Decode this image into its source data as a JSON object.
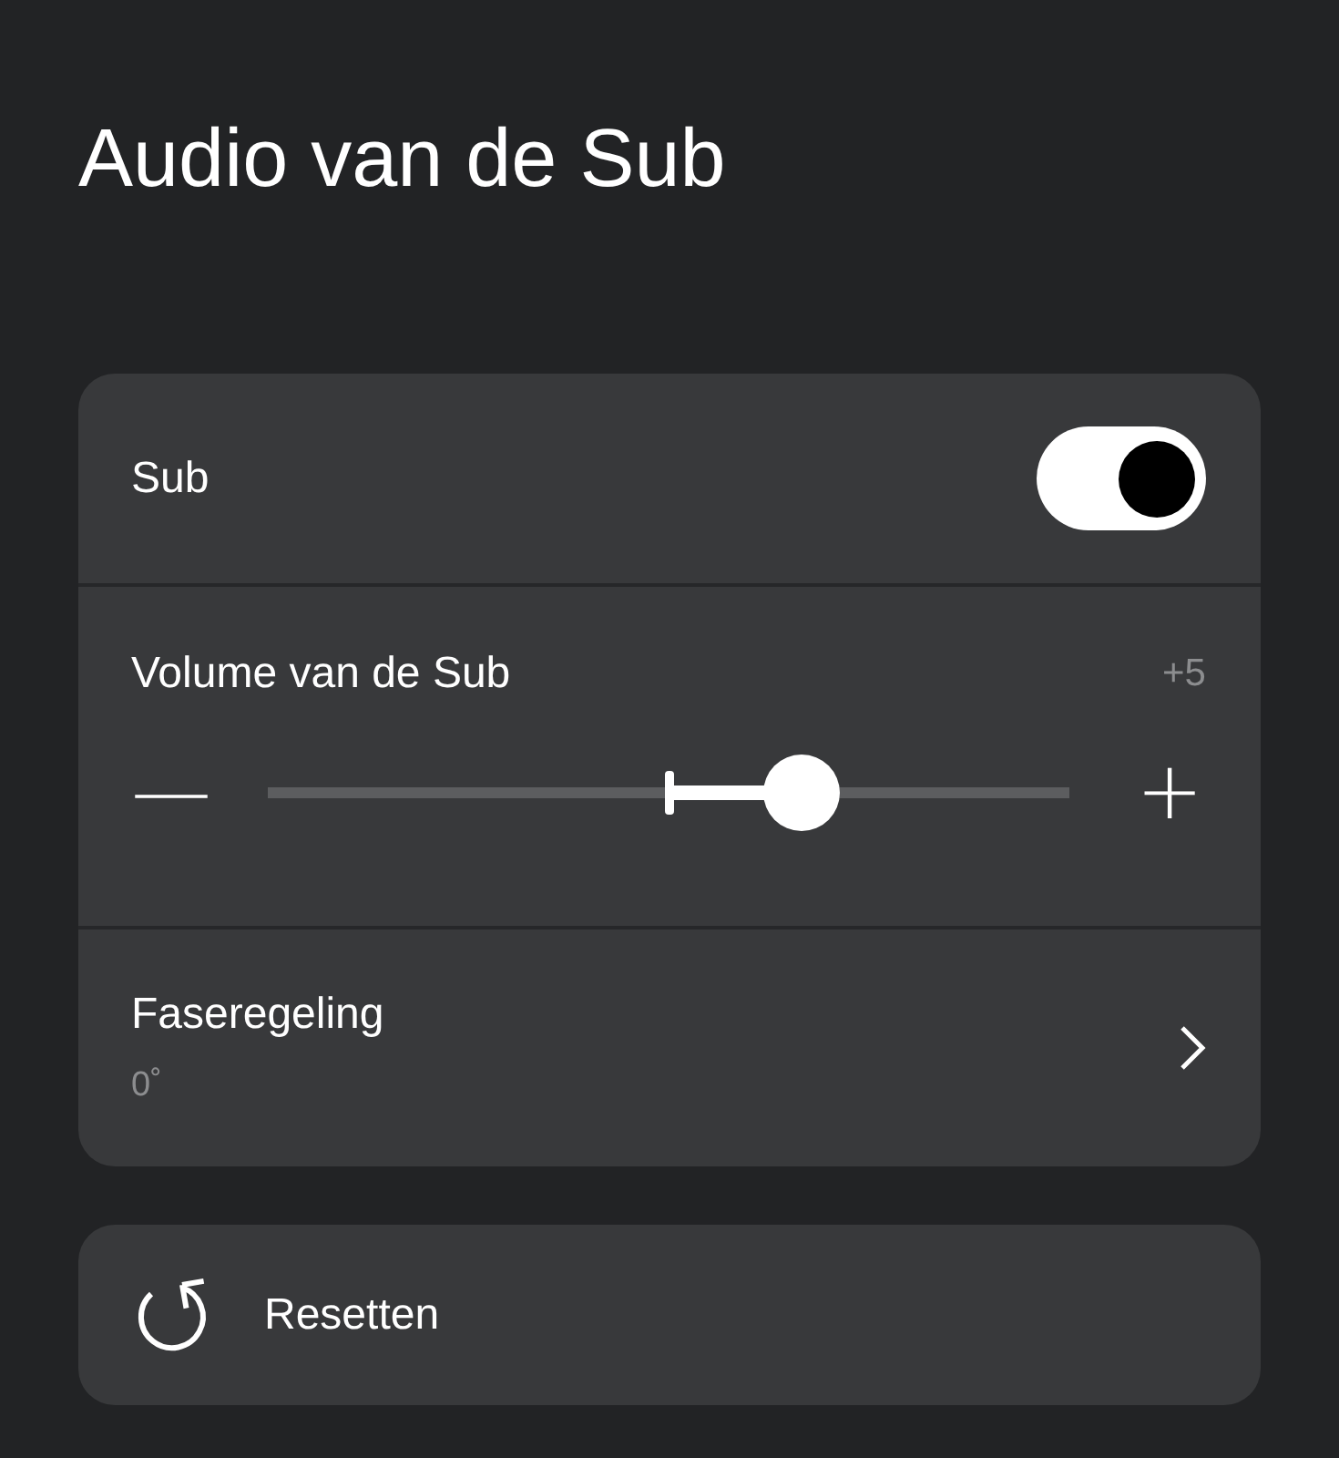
{
  "title": "Audio van de Sub",
  "settings": [
    {
      "kind": "toggle",
      "label": "Sub",
      "on": true
    },
    {
      "kind": "slider",
      "label": "Volume van de Sub",
      "reading": "+5",
      "minus": "—",
      "plus": "+",
      "level": 0.665
    },
    {
      "kind": "link",
      "label": "Faseregeling",
      "value": "0˚"
    }
  ],
  "reset": {
    "label": "Resetten"
  }
}
